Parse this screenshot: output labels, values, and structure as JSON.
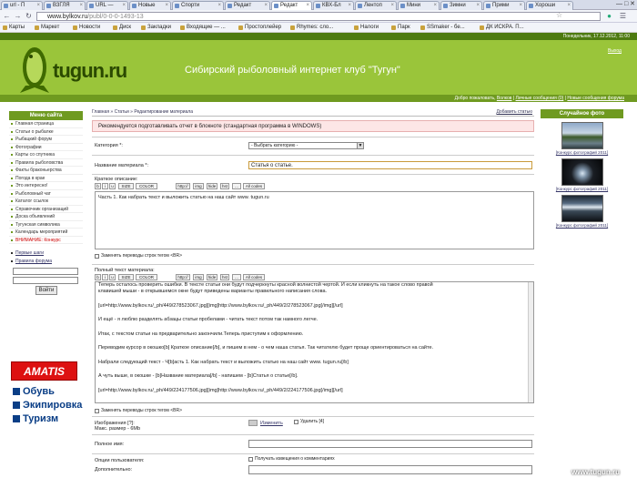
{
  "browser": {
    "tabs": [
      {
        "label": "url - П"
      },
      {
        "label": "ВЗГЛЯ"
      },
      {
        "label": "URL —"
      },
      {
        "label": "Новые"
      },
      {
        "label": "Спорти"
      },
      {
        "label": "Редакт"
      },
      {
        "label": "Редакт"
      },
      {
        "label": "КВХ-Бл"
      },
      {
        "label": "Лентоп"
      },
      {
        "label": "Мини"
      },
      {
        "label": "Зимни"
      },
      {
        "label": "Прими"
      },
      {
        "label": "Хороши"
      }
    ],
    "url_domain": "www.bylkov.ru",
    "url_path": "/publ/0-0-0-1493-13",
    "bookmarks": [
      "Карты",
      "Маркет",
      "Новости",
      "Диск",
      "Закладки",
      "Входящие — ...",
      "Простоплейер",
      "Rhymes: сло...",
      "Налоги",
      "Парк",
      "SSmaker - бе...",
      "ДК ИСКРА. П..."
    ]
  },
  "site": {
    "topstrip": "Понедельник, 17.12.2012, 11:00",
    "logo": "tugun.ru",
    "title": "Сибирский рыболовный интернет клуб \"Тугун\"",
    "login_link": "Выход",
    "welcome_prefix": "Добро пожаловать,",
    "welcome_user": "Волков",
    "welcome_msgs": "Личные сообщения (0)",
    "welcome_new": "Новые сообщения форума"
  },
  "left": {
    "head": "Меню сайта",
    "items": [
      "Главная страница",
      "Статьи о рыбалке",
      "Рыбацкий форум",
      "Фотографии",
      "Карты со спутника",
      "Правила рыболовства",
      "Факты браконьерства",
      "Погода в крае",
      "Это интересно!",
      "Рыболовный чат",
      "Каталог ссылок",
      "Справочник организаций",
      "Доска объявлений",
      "Тугунская символика",
      "Календарь мероприятий",
      "ВНИМАНИЕ: Конкурс"
    ],
    "links": [
      "Первые шаги",
      "Правила форума"
    ],
    "login_btn": "Войти",
    "amatis": "AMATIS",
    "ads": [
      "Обувь",
      "Экипировка",
      "Туризм"
    ]
  },
  "center": {
    "breadcrumb": "Главная » Статьи » Редактирование материала",
    "add_article": "Добавить статью",
    "notice": "Рекомендуется подготавливать отчет в блокноте (стандартная программа в WINDOWS)",
    "category_label": "Категория *:",
    "category_value": "- Выбрать категорию -",
    "title_label": "Название материала *:",
    "title_value": "Статья о статье.",
    "brief_label": "Краткое описание:",
    "toolbar": [
      "b",
      "i",
      "u",
      "SIZE",
      "COLOR",
      "http://",
      "img",
      "hide",
      "hst",
      "...",
      "All codes"
    ],
    "brief_text": "Часть 1. Как набрать текст и выложить статью на наш сайт www. tugun.ru",
    "replace_br": "Заменять переводы строк тегом <BR>",
    "full_label": "Полный текст материала:",
    "full_lines": [
      "Теперь осталось проверить ошибки. В тексте статьи они будут подчеркнуты красной волнистой чертой. И если кликнуть на такое слово правой",
      "клавишей мыши - в открывшемся окне будут приведены варианты правильного написания слова.",
      "[url=http://www.bylkov.ru/_ph/449/278523067.jpg][img]http://www.bylkov.ru/_ph/449/2/278523067.jpg[/img][/url]",
      "И ещё - я люблю разделять абзацы статьи пробелами - читать текст потом так намного легче.",
      "Итак, с текстом статьи на предварительно закончили.Теперь приступим к оформлению.",
      "Переводим курсор в окошко[b] Краткое описание[/b], и пишем в нем - о чем наша статья. Так читателю будет проще ориентироваться на сайте.",
      "Набрали следующий текст - Ч[b]асть 1. Как набрать текст и выложить статью на наш сайт www. tugun.ru[/b]",
      "А чуть выше, в окошке - [b]Название материала[/b] - напишем - [b]Статья о статье[/b].",
      "[url=http://www.bylkov.ru/_ph/449/224177506.jpg][img]http://www.bylkov.ru/_ph/449/2/224177506.jpg[/img][/url]"
    ],
    "images_label": "Изображения [?]:",
    "images_max": "Макс. размер - 6Mb",
    "change": "Изменить",
    "delete": "Удалить",
    "delete_num": "[4]",
    "fullname_label": "Полное имя:",
    "options_label": "Опции пользователя:",
    "options_value": "Получать извещения о комментариях",
    "extra_label": "Дополнительно:"
  },
  "right": {
    "head": "Случайное фото",
    "caption": "[Конкурс фотографий 2011]"
  },
  "footer_logo": "www.tugun.ru"
}
